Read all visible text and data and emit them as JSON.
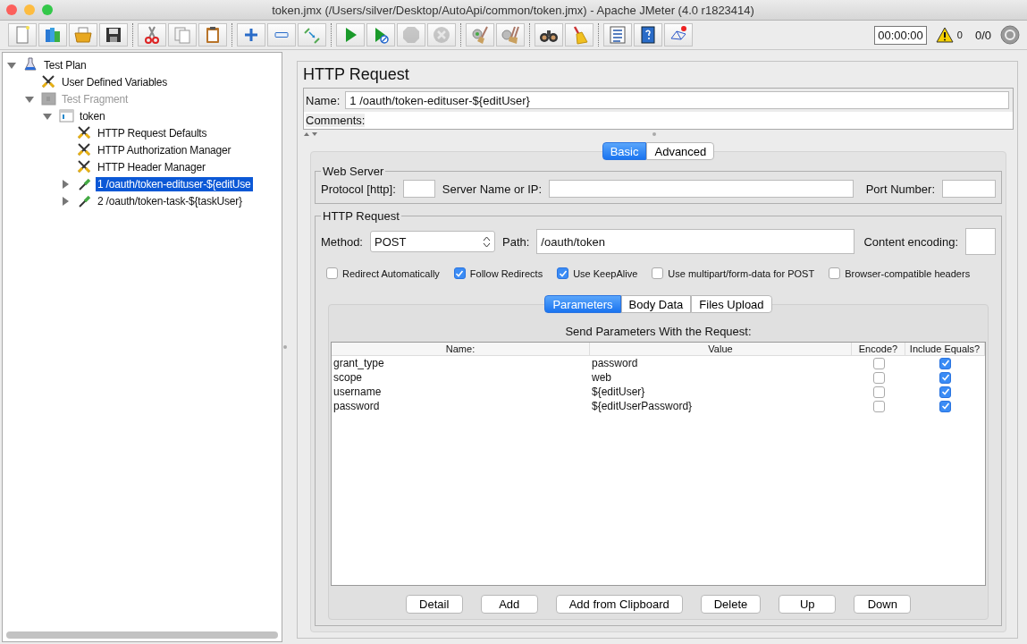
{
  "window": {
    "title": "token.jmx (/Users/silver/Desktop/AutoApi/common/token.jmx) - Apache JMeter (4.0 r1823414)"
  },
  "toolbar": {
    "groups": [
      [
        {
          "kind": "new",
          "disabled": false
        },
        {
          "kind": "templates",
          "disabled": false
        },
        {
          "kind": "open",
          "disabled": false
        },
        {
          "kind": "save",
          "disabled": false
        }
      ],
      [
        {
          "kind": "cut",
          "disabled": false
        },
        {
          "kind": "copy",
          "disabled": false
        },
        {
          "kind": "paste",
          "disabled": false
        }
      ],
      [
        {
          "kind": "expand",
          "disabled": false
        },
        {
          "kind": "collapse",
          "disabled": false
        },
        {
          "kind": "toggle",
          "disabled": false
        }
      ],
      [
        {
          "kind": "start",
          "disabled": false
        },
        {
          "kind": "start_no_pauses",
          "disabled": false
        },
        {
          "kind": "stop",
          "disabled": true
        },
        {
          "kind": "shutdown",
          "disabled": true
        }
      ],
      [
        {
          "kind": "clear",
          "disabled": false
        },
        {
          "kind": "clear_all",
          "disabled": false
        }
      ],
      [
        {
          "kind": "search",
          "disabled": false
        },
        {
          "kind": "reset_search",
          "disabled": false
        }
      ],
      [
        {
          "kind": "function_helper",
          "disabled": false
        },
        {
          "kind": "help",
          "disabled": false
        },
        {
          "kind": "log",
          "disabled": false
        }
      ]
    ],
    "timer": "00:00:00",
    "warnings": "0",
    "threads": "0/0"
  },
  "tree": [
    {
      "label": "Test Plan",
      "kind": "testplan",
      "expanded": true,
      "selected": false,
      "disabled": false,
      "children": [
        {
          "label": "User Defined Variables",
          "kind": "config",
          "selected": false,
          "disabled": false
        },
        {
          "label": "Test Fragment",
          "kind": "fragment",
          "expanded": true,
          "selected": false,
          "disabled": true,
          "children": [
            {
              "label": "token",
              "kind": "controller",
              "expanded": true,
              "selected": false,
              "disabled": false,
              "children": [
                {
                  "label": "HTTP Request Defaults",
                  "kind": "config",
                  "selected": false,
                  "disabled": false
                },
                {
                  "label": "HTTP Authorization Manager",
                  "kind": "config",
                  "selected": false,
                  "disabled": false
                },
                {
                  "label": "HTTP Header Manager",
                  "kind": "config",
                  "selected": false,
                  "disabled": false
                },
                {
                  "label": "1  /oauth/token-edituser-${editUse",
                  "kind": "sampler",
                  "expanded": false,
                  "selected": true,
                  "disabled": false
                },
                {
                  "label": "2  /oauth/token-task-${taskUser}",
                  "kind": "sampler",
                  "expanded": false,
                  "selected": false,
                  "disabled": false
                }
              ]
            }
          ]
        }
      ]
    }
  ],
  "editor": {
    "title": "HTTP Request",
    "name_label": "Name:",
    "name": "1 /oauth/token-edituser-${editUser}",
    "comments_label": "Comments:",
    "tabs": [
      {
        "label": "Basic",
        "selected": true
      },
      {
        "label": "Advanced",
        "selected": false
      }
    ],
    "web_server": {
      "legend": "Web Server",
      "protocol_label": "Protocol [http]:",
      "server_label": "Server Name or IP:",
      "port_label": "Port Number:"
    },
    "http_request": {
      "legend": "HTTP Request",
      "method_label": "Method:",
      "method": "POST",
      "path_label": "Path:",
      "path": "/oauth/token",
      "encoding_label": "Content encoding:",
      "options": [
        {
          "label": "Redirect Automatically",
          "checked": false
        },
        {
          "label": "Follow Redirects",
          "checked": true
        },
        {
          "label": "Use KeepAlive",
          "checked": true
        },
        {
          "label": "Use multipart/form-data for POST",
          "checked": false
        },
        {
          "label": "Browser-compatible headers",
          "checked": false
        }
      ]
    },
    "param_tabs": [
      {
        "label": "Parameters",
        "selected": true
      },
      {
        "label": "Body Data",
        "selected": false
      },
      {
        "label": "Files Upload",
        "selected": false
      }
    ],
    "table": {
      "title": "Send Parameters With the Request:",
      "columns": [
        "Name:",
        "Value",
        "Encode?",
        "Include Equals?"
      ],
      "rows": [
        {
          "name": "grant_type",
          "value": "password",
          "encode": false,
          "include_equals": true
        },
        {
          "name": "scope",
          "value": "web",
          "encode": false,
          "include_equals": true
        },
        {
          "name": "username",
          "value": "${editUser}",
          "encode": false,
          "include_equals": true
        },
        {
          "name": "password",
          "value": "${editUserPassword}",
          "encode": false,
          "include_equals": true
        }
      ]
    },
    "buttons": [
      "Detail",
      "Add",
      "Add from Clipboard",
      "Delete",
      "Up",
      "Down"
    ]
  }
}
